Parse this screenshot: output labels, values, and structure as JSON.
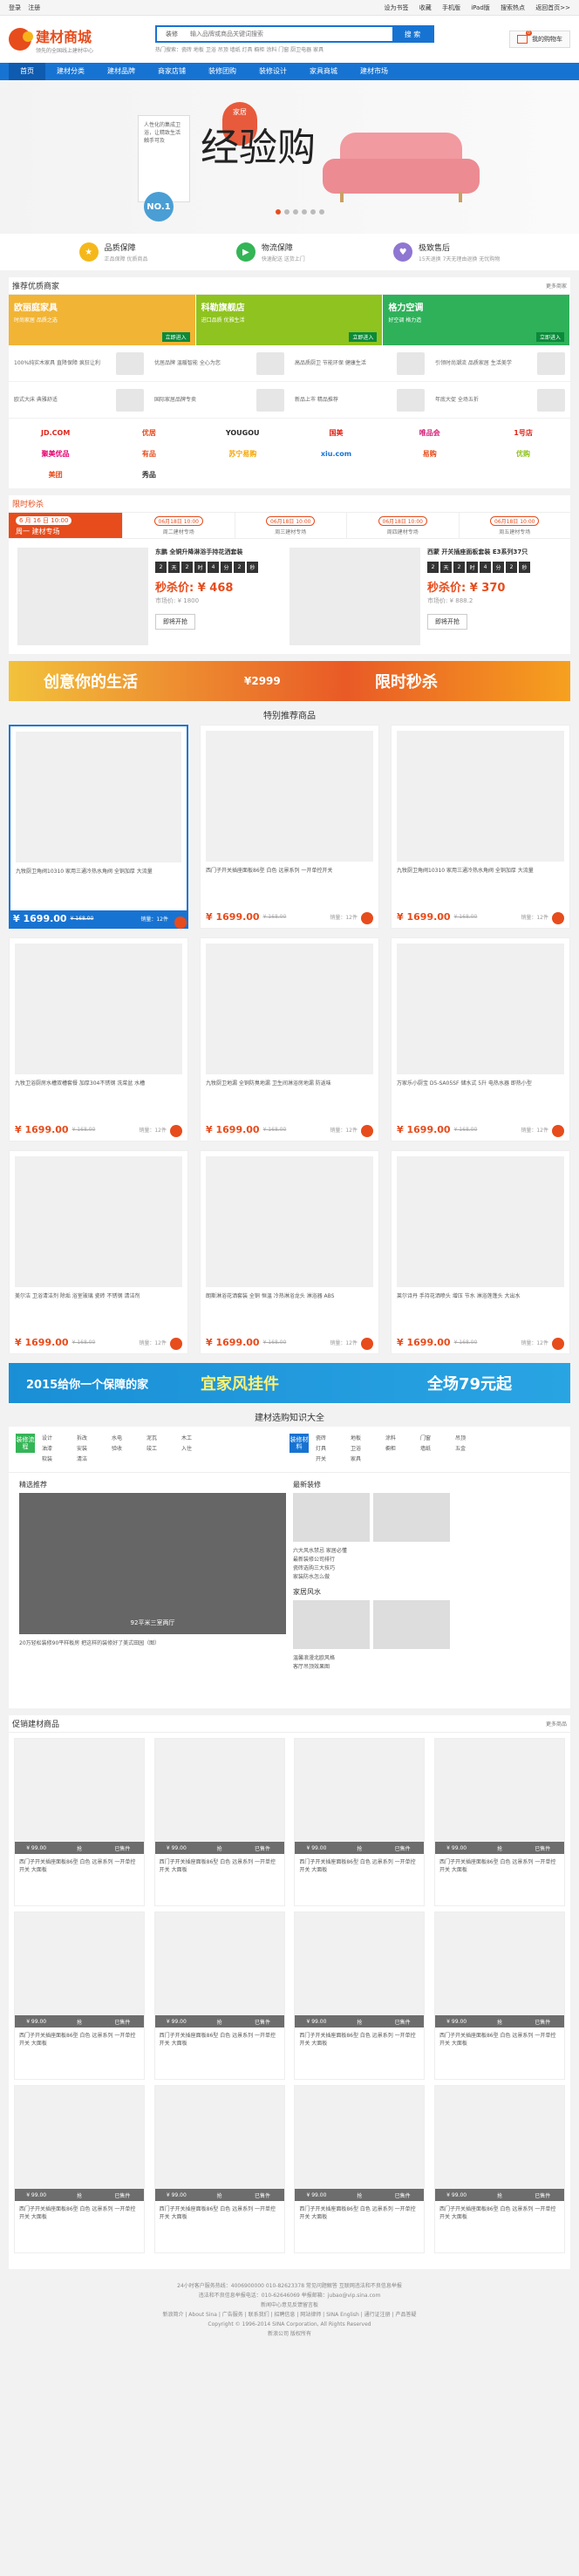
{
  "topbar": {
    "login": "登录",
    "register": "注册",
    "links": [
      "设为书签",
      "收藏",
      "手机版",
      "iPad版",
      "搜索热点",
      "返回首页>>"
    ]
  },
  "header": {
    "logo": "建材商城",
    "logo_sub": "领先的全国线上建材中心",
    "search_scope": "装修",
    "search_placeholder": "输入品牌或商品关键词搜索",
    "search_button": "搜 索",
    "hot_words": "热门搜索：瓷砖 地板 卫浴 吊顶 墙纸 灯具 橱柜 涂料 门窗 厨卫电器 家具",
    "cart_label": "我的购物车",
    "cart_count": "0"
  },
  "nav": [
    "首页",
    "建材分类",
    "建材品牌",
    "商家店铺",
    "装修团购",
    "装修设计",
    "家具商城",
    "建材市场"
  ],
  "banner": {
    "board_text": "人性化的集成卫浴，让精致生活触手可及",
    "no1": "NO.1",
    "pill": "家居",
    "big": "经验购"
  },
  "features": [
    {
      "title": "品质保障",
      "desc": "正品保障 优质商品",
      "color": "#f5b81b"
    },
    {
      "title": "物流保障",
      "desc": "快速配送 送货上门",
      "color": "#34b556"
    },
    {
      "title": "极致售后",
      "desc": "15天退换 7天无理由退换 无忧购物",
      "color": "#8e76d2"
    }
  ],
  "merchants": {
    "title": "推荐优质商家",
    "more": "更多商家",
    "top": [
      {
        "title": "欧丽庭家具",
        "sub": "时尚家居 品质之选",
        "color": "#f1b435"
      },
      {
        "title": "科勒旗舰店",
        "sub": "进口品质 优雅生活",
        "color": "#8fc31f"
      },
      {
        "title": "格力空调",
        "sub": "好空调 格力造",
        "color": "#2fb15a"
      }
    ],
    "top_btn": "立即进入",
    "rows": [
      [
        "100%纯实木家具 直降保障 疯狂让利",
        "优居品牌 温暖智能 全心为您",
        "高品质厨卫 节能环保 健康生活",
        "引领时尚潮流 品质家居 生活美学"
      ],
      [
        "欧式大床 典雅舒适",
        "国际家居品牌专卖",
        "新品上市 精品推荐",
        "年底大促 全场五折"
      ]
    ],
    "logos": [
      {
        "text": "JD.COM",
        "color": "#e1251b"
      },
      {
        "text": "优居",
        "color": "#e74c1c"
      },
      {
        "text": "YOUGOU",
        "color": "#2b2b2b"
      },
      {
        "text": "国美",
        "color": "#e1251b"
      },
      {
        "text": "唯品会",
        "color": "#d4237a"
      },
      {
        "text": "1号店",
        "color": "#e1251b"
      },
      {
        "text": "聚美优品",
        "color": "#e5006e"
      },
      {
        "text": "有品",
        "color": "#e74c1c"
      },
      {
        "text": "苏宁易购",
        "color": "#f6a400"
      },
      {
        "text": "xiu.com",
        "color": "#1773d2"
      },
      {
        "text": "易购",
        "color": "#e74c1c"
      },
      {
        "text": "优购",
        "color": "#8fc31f"
      },
      {
        "text": "美团",
        "color": "#e74c1c"
      },
      {
        "text": "秀品",
        "color": "#333"
      }
    ]
  },
  "flash": {
    "title": "限时秒杀",
    "first_date": "6 月 16 日 10:00",
    "first_label": "周一 建材专场",
    "slots": [
      {
        "date": "06月18日 10:00",
        "label": "周二建材专场"
      },
      {
        "date": "06月18日 10:00",
        "label": "周三建材专场"
      },
      {
        "date": "06月18日 10:00",
        "label": "周四建材专场"
      },
      {
        "date": "06月18日 10:00",
        "label": "周五建材专场"
      }
    ],
    "items": [
      {
        "name": "东鹏 全铜升降淋浴手持花洒套装",
        "timer": [
          "2",
          "天",
          "2",
          "时",
          "4",
          "分",
          "2",
          "秒"
        ],
        "price": "秒杀价: ¥ 468",
        "orig": "市场价: ¥ 1800",
        "go": "即将开抢"
      },
      {
        "name": "西蒙 开关插座面板套装 E3系列37只",
        "timer": [
          "2",
          "天",
          "2",
          "时",
          "4",
          "分",
          "2",
          "秒"
        ],
        "price": "秒杀价: ¥ 370",
        "orig": "市场价: ¥ 888.2",
        "go": "即将开抢"
      }
    ]
  },
  "ad1": {
    "left": "创意你的生活",
    "right": "限时秒杀",
    "price": "¥2999"
  },
  "special": {
    "title": "特别推荐商品",
    "cards": [
      {
        "desc": "九牧厨卫角阀10310 家用三通冷热水角阀 全铜加厚 大流量",
        "price": "¥ 1699.00",
        "orig": "¥ 168.00",
        "sold": "销量：12件"
      },
      {
        "desc": "西门子开关插座面板86型 白色 远景系列 一开单控开关",
        "price": "¥ 1699.00",
        "orig": "¥ 168.00",
        "sold": "销量：12件"
      },
      {
        "desc": "九牧厨卫角阀10310 家用三通冷热水角阀 全铜加厚 大流量",
        "price": "¥ 1699.00",
        "orig": "¥ 168.00",
        "sold": "销量：12件"
      },
      {
        "desc": "九牧卫浴厨房水槽双槽套餐 加厚304不锈钢 洗菜盆 水槽",
        "price": "¥ 1699.00",
        "orig": "¥ 168.00",
        "sold": "销量：12件"
      },
      {
        "desc": "九牧厨卫地漏 全铜防臭地漏 卫生间淋浴房地漏 防返味",
        "price": "¥ 1699.00",
        "orig": "¥ 168.00",
        "sold": "销量：12件"
      },
      {
        "desc": "万家乐小厨宝 D5-SA05SF 储水式 5升 电热水器 即热小型",
        "price": "¥ 1699.00",
        "orig": "¥ 168.00",
        "sold": "销量：12件"
      },
      {
        "desc": "美尔洁 卫浴清洁剂 除垢 浴室玻璃 瓷砖 不锈钢 清洁剂",
        "price": "¥ 1699.00",
        "orig": "¥ 168.00",
        "sold": "销量：12件"
      },
      {
        "desc": "朗斯淋浴花洒套装 全铜 恒温 冷热淋浴龙头 淋浴器 ABS",
        "price": "¥ 1699.00",
        "orig": "¥ 168.00",
        "sold": "销量：12件"
      },
      {
        "desc": "莱尔诗丹 手持花洒喷头 增压 节水 淋浴莲蓬头 大出水",
        "price": "¥ 1699.00",
        "orig": "¥ 168.00",
        "sold": "销量：12件"
      }
    ]
  },
  "ad2": {
    "left": "2015给你一个保障的家",
    "mid": "宜家风挂件",
    "right": "全场79元起"
  },
  "knowledge": {
    "title": "建材选购知识大全",
    "tags": [
      {
        "label": "装修流程",
        "color": "#34b556",
        "items": [
          "设计",
          "拆改",
          "水电",
          "泥瓦",
          "木工",
          "油漆",
          "安装",
          "验收",
          "竣工",
          "入住",
          "软装",
          "清洁"
        ]
      },
      {
        "label": "装修材料",
        "color": "#1773d2",
        "items": [
          "瓷砖",
          "地板",
          "涂料",
          "门窗",
          "吊顶",
          "灯具",
          "卫浴",
          "橱柜",
          "墙纸",
          "五金",
          "开关",
          "家具"
        ]
      }
    ],
    "col1_title": "精选推荐",
    "hero_caption": "92平米三室两厅",
    "hero_desc": "20万轻松装修90平样板房 把这样的装修好了美式田园（图）",
    "col2_title": "最新装修",
    "col2_list": [
      "六大风水禁忌 家居必懂",
      "最新装修公司排行",
      "瓷砖选购三大技巧",
      "家装防水怎么做"
    ],
    "col3_title": "家居风水",
    "col3_list": [
      "温馨浪漫北欧风格",
      "客厅吊顶效果图",
      "卫生间装修注意事项",
      "厨房收纳小妙招"
    ]
  },
  "promo": {
    "title": "促销建材商品",
    "more": "更多商品",
    "sale_labels": [
      "¥ 99.00",
      "抢",
      "已售件"
    ],
    "items": [
      {
        "desc": "西门子开关插座面板86型 白色 远景系列 一开单控开关 大面板"
      },
      {
        "desc": "西门子开关插座面板86型 白色 远景系列 一开单控开关 大面板"
      },
      {
        "desc": "西门子开关插座面板86型 白色 远景系列 一开单控开关 大面板"
      },
      {
        "desc": "西门子开关插座面板86型 白色 远景系列 一开单控开关 大面板"
      },
      {
        "desc": "西门子开关插座面板86型 白色 远景系列 一开单控开关 大面板"
      },
      {
        "desc": "西门子开关插座面板86型 白色 远景系列 一开单控开关 大面板"
      },
      {
        "desc": "西门子开关插座面板86型 白色 远景系列 一开单控开关 大面板"
      },
      {
        "desc": "西门子开关插座面板86型 白色 远景系列 一开单控开关 大面板"
      },
      {
        "desc": "西门子开关插座面板86型 白色 远景系列 一开单控开关 大面板"
      },
      {
        "desc": "西门子开关插座面板86型 白色 远景系列 一开单控开关 大面板"
      },
      {
        "desc": "西门子开关插座面板86型 白色 远景系列 一开单控开关 大面板"
      },
      {
        "desc": "西门子开关插座面板86型 白色 远景系列 一开单控开关 大面板"
      }
    ]
  },
  "footer": {
    "lines": [
      "24小时客户服务热线：4006900000 010-82623378 常见问题解答 互联网违法和不良信息举报",
      "违法和不良信息举报电话：010-62646069 举报邮箱：jubao@vip.sina.com",
      "新闻中心意见反馈留言板",
      "新浪简介 | About Sina | 广告服务 | 联系我们 | 招聘信息 | 网站律师 | SINA English | 通行证注册 | 产品答疑",
      "Copyright © 1996-2014 SINA Corporation, All Rights Reserved",
      "新浪公司 版权所有"
    ]
  }
}
